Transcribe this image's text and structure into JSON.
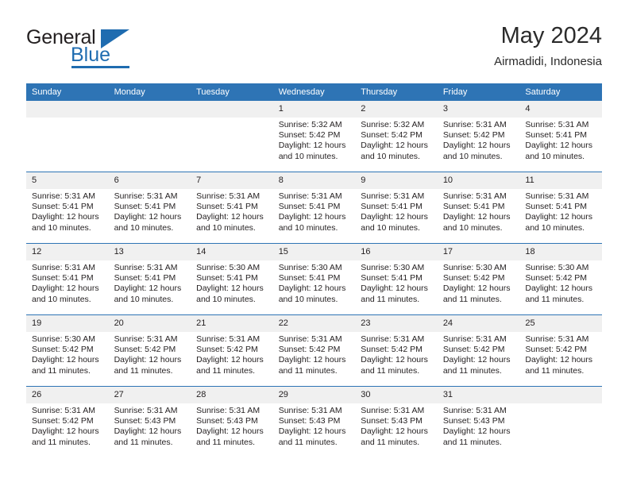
{
  "brand": {
    "name_top": "General",
    "name_bottom": "Blue",
    "accent_color": "#1f6cb0"
  },
  "header": {
    "title": "May 2024",
    "subtitle": "Airmadidi, Indonesia"
  },
  "theme": {
    "header_blue": "#2e74b5",
    "daynum_band": "#f0f0f0",
    "text": "#231f20"
  },
  "labels": {
    "sunrise_prefix": "Sunrise:",
    "sunset_prefix": "Sunset:",
    "daylight_prefix": "Daylight:"
  },
  "weekdays": [
    "Sunday",
    "Monday",
    "Tuesday",
    "Wednesday",
    "Thursday",
    "Friday",
    "Saturday"
  ],
  "weeks": [
    [
      {
        "day": "",
        "sunrise": "",
        "sunset": "",
        "daylight": "",
        "daylight2": ""
      },
      {
        "day": "",
        "sunrise": "",
        "sunset": "",
        "daylight": "",
        "daylight2": ""
      },
      {
        "day": "",
        "sunrise": "",
        "sunset": "",
        "daylight": "",
        "daylight2": ""
      },
      {
        "day": "1",
        "sunrise": "Sunrise: 5:32 AM",
        "sunset": "Sunset: 5:42 PM",
        "daylight": "Daylight: 12 hours",
        "daylight2": "and 10 minutes."
      },
      {
        "day": "2",
        "sunrise": "Sunrise: 5:32 AM",
        "sunset": "Sunset: 5:42 PM",
        "daylight": "Daylight: 12 hours",
        "daylight2": "and 10 minutes."
      },
      {
        "day": "3",
        "sunrise": "Sunrise: 5:31 AM",
        "sunset": "Sunset: 5:42 PM",
        "daylight": "Daylight: 12 hours",
        "daylight2": "and 10 minutes."
      },
      {
        "day": "4",
        "sunrise": "Sunrise: 5:31 AM",
        "sunset": "Sunset: 5:41 PM",
        "daylight": "Daylight: 12 hours",
        "daylight2": "and 10 minutes."
      }
    ],
    [
      {
        "day": "5",
        "sunrise": "Sunrise: 5:31 AM",
        "sunset": "Sunset: 5:41 PM",
        "daylight": "Daylight: 12 hours",
        "daylight2": "and 10 minutes."
      },
      {
        "day": "6",
        "sunrise": "Sunrise: 5:31 AM",
        "sunset": "Sunset: 5:41 PM",
        "daylight": "Daylight: 12 hours",
        "daylight2": "and 10 minutes."
      },
      {
        "day": "7",
        "sunrise": "Sunrise: 5:31 AM",
        "sunset": "Sunset: 5:41 PM",
        "daylight": "Daylight: 12 hours",
        "daylight2": "and 10 minutes."
      },
      {
        "day": "8",
        "sunrise": "Sunrise: 5:31 AM",
        "sunset": "Sunset: 5:41 PM",
        "daylight": "Daylight: 12 hours",
        "daylight2": "and 10 minutes."
      },
      {
        "day": "9",
        "sunrise": "Sunrise: 5:31 AM",
        "sunset": "Sunset: 5:41 PM",
        "daylight": "Daylight: 12 hours",
        "daylight2": "and 10 minutes."
      },
      {
        "day": "10",
        "sunrise": "Sunrise: 5:31 AM",
        "sunset": "Sunset: 5:41 PM",
        "daylight": "Daylight: 12 hours",
        "daylight2": "and 10 minutes."
      },
      {
        "day": "11",
        "sunrise": "Sunrise: 5:31 AM",
        "sunset": "Sunset: 5:41 PM",
        "daylight": "Daylight: 12 hours",
        "daylight2": "and 10 minutes."
      }
    ],
    [
      {
        "day": "12",
        "sunrise": "Sunrise: 5:31 AM",
        "sunset": "Sunset: 5:41 PM",
        "daylight": "Daylight: 12 hours",
        "daylight2": "and 10 minutes."
      },
      {
        "day": "13",
        "sunrise": "Sunrise: 5:31 AM",
        "sunset": "Sunset: 5:41 PM",
        "daylight": "Daylight: 12 hours",
        "daylight2": "and 10 minutes."
      },
      {
        "day": "14",
        "sunrise": "Sunrise: 5:30 AM",
        "sunset": "Sunset: 5:41 PM",
        "daylight": "Daylight: 12 hours",
        "daylight2": "and 10 minutes."
      },
      {
        "day": "15",
        "sunrise": "Sunrise: 5:30 AM",
        "sunset": "Sunset: 5:41 PM",
        "daylight": "Daylight: 12 hours",
        "daylight2": "and 10 minutes."
      },
      {
        "day": "16",
        "sunrise": "Sunrise: 5:30 AM",
        "sunset": "Sunset: 5:41 PM",
        "daylight": "Daylight: 12 hours",
        "daylight2": "and 11 minutes."
      },
      {
        "day": "17",
        "sunrise": "Sunrise: 5:30 AM",
        "sunset": "Sunset: 5:42 PM",
        "daylight": "Daylight: 12 hours",
        "daylight2": "and 11 minutes."
      },
      {
        "day": "18",
        "sunrise": "Sunrise: 5:30 AM",
        "sunset": "Sunset: 5:42 PM",
        "daylight": "Daylight: 12 hours",
        "daylight2": "and 11 minutes."
      }
    ],
    [
      {
        "day": "19",
        "sunrise": "Sunrise: 5:30 AM",
        "sunset": "Sunset: 5:42 PM",
        "daylight": "Daylight: 12 hours",
        "daylight2": "and 11 minutes."
      },
      {
        "day": "20",
        "sunrise": "Sunrise: 5:31 AM",
        "sunset": "Sunset: 5:42 PM",
        "daylight": "Daylight: 12 hours",
        "daylight2": "and 11 minutes."
      },
      {
        "day": "21",
        "sunrise": "Sunrise: 5:31 AM",
        "sunset": "Sunset: 5:42 PM",
        "daylight": "Daylight: 12 hours",
        "daylight2": "and 11 minutes."
      },
      {
        "day": "22",
        "sunrise": "Sunrise: 5:31 AM",
        "sunset": "Sunset: 5:42 PM",
        "daylight": "Daylight: 12 hours",
        "daylight2": "and 11 minutes."
      },
      {
        "day": "23",
        "sunrise": "Sunrise: 5:31 AM",
        "sunset": "Sunset: 5:42 PM",
        "daylight": "Daylight: 12 hours",
        "daylight2": "and 11 minutes."
      },
      {
        "day": "24",
        "sunrise": "Sunrise: 5:31 AM",
        "sunset": "Sunset: 5:42 PM",
        "daylight": "Daylight: 12 hours",
        "daylight2": "and 11 minutes."
      },
      {
        "day": "25",
        "sunrise": "Sunrise: 5:31 AM",
        "sunset": "Sunset: 5:42 PM",
        "daylight": "Daylight: 12 hours",
        "daylight2": "and 11 minutes."
      }
    ],
    [
      {
        "day": "26",
        "sunrise": "Sunrise: 5:31 AM",
        "sunset": "Sunset: 5:42 PM",
        "daylight": "Daylight: 12 hours",
        "daylight2": "and 11 minutes."
      },
      {
        "day": "27",
        "sunrise": "Sunrise: 5:31 AM",
        "sunset": "Sunset: 5:43 PM",
        "daylight": "Daylight: 12 hours",
        "daylight2": "and 11 minutes."
      },
      {
        "day": "28",
        "sunrise": "Sunrise: 5:31 AM",
        "sunset": "Sunset: 5:43 PM",
        "daylight": "Daylight: 12 hours",
        "daylight2": "and 11 minutes."
      },
      {
        "day": "29",
        "sunrise": "Sunrise: 5:31 AM",
        "sunset": "Sunset: 5:43 PM",
        "daylight": "Daylight: 12 hours",
        "daylight2": "and 11 minutes."
      },
      {
        "day": "30",
        "sunrise": "Sunrise: 5:31 AM",
        "sunset": "Sunset: 5:43 PM",
        "daylight": "Daylight: 12 hours",
        "daylight2": "and 11 minutes."
      },
      {
        "day": "31",
        "sunrise": "Sunrise: 5:31 AM",
        "sunset": "Sunset: 5:43 PM",
        "daylight": "Daylight: 12 hours",
        "daylight2": "and 11 minutes."
      },
      {
        "day": "",
        "sunrise": "",
        "sunset": "",
        "daylight": "",
        "daylight2": ""
      }
    ]
  ]
}
